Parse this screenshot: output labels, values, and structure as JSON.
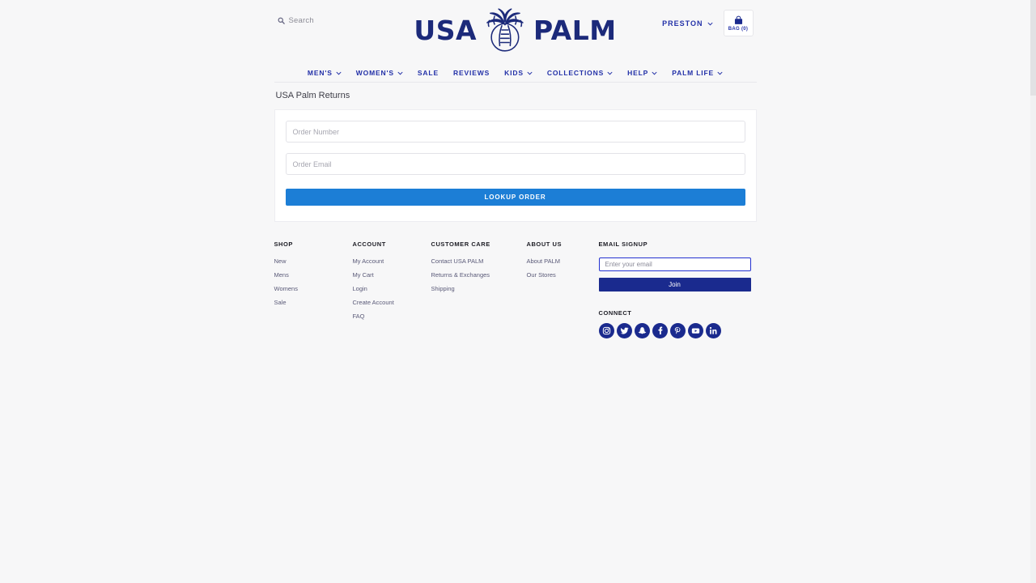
{
  "header": {
    "search": {
      "label": "Search",
      "icon": "search-icon"
    },
    "logo": {
      "word_left": "USA",
      "word_right": "PALM",
      "mark": "palm-tree-icon"
    },
    "account_name": "PRESTON",
    "bag_label": "BAG (0)",
    "bag_icon": "shopping-bag-icon"
  },
  "nav": {
    "items": [
      {
        "label": "MEN'S",
        "caret": true
      },
      {
        "label": "WOMEN'S",
        "caret": true
      },
      {
        "label": "SALE",
        "caret": false
      },
      {
        "label": "REVIEWS",
        "caret": false
      },
      {
        "label": "KIDS",
        "caret": true
      },
      {
        "label": "COLLECTIONS",
        "caret": true
      },
      {
        "label": "HELP",
        "caret": true
      },
      {
        "label": "PALM LIFE",
        "caret": true
      }
    ]
  },
  "main": {
    "title": "USA Palm Returns",
    "order_number": {
      "value": "",
      "placeholder": "Order Number"
    },
    "order_email": {
      "value": "",
      "placeholder": "Order Email"
    },
    "lookup_label": "LOOKUP ORDER"
  },
  "footer": {
    "shop": {
      "heading": "SHOP",
      "links": [
        "New",
        "Mens",
        "Womens",
        "Sale"
      ]
    },
    "account": {
      "heading": "ACCOUNT",
      "links": [
        "My Account",
        "My Cart",
        "Login",
        "Create Account",
        "FAQ"
      ]
    },
    "customer_care": {
      "heading": "CUSTOMER CARE",
      "links": [
        "Contact USA PALM",
        "Returns & Exchanges",
        "Shipping"
      ]
    },
    "about_us": {
      "heading": "ABOUT US",
      "links": [
        "About PALM",
        "Our Stores"
      ]
    },
    "signup": {
      "heading": "EMAIL SIGNUP",
      "email": {
        "value": "",
        "placeholder": "Enter your email"
      },
      "join_label": "Join"
    },
    "connect": {
      "heading": "CONNECT",
      "socials": [
        "instagram-icon",
        "twitter-icon",
        "snapchat-icon",
        "facebook-icon",
        "pinterest-icon",
        "youtube-icon",
        "linkedin-icon"
      ]
    }
  },
  "colors": {
    "page_bg": "#f7f7f8",
    "brand_navy": "#1c2a7a",
    "nav_blue": "#2331a8",
    "accent_blue": "#1c7ed6",
    "join_navy": "#1a2a8e",
    "card_bg": "#ffffff",
    "link_gray": "#5a5a78"
  }
}
